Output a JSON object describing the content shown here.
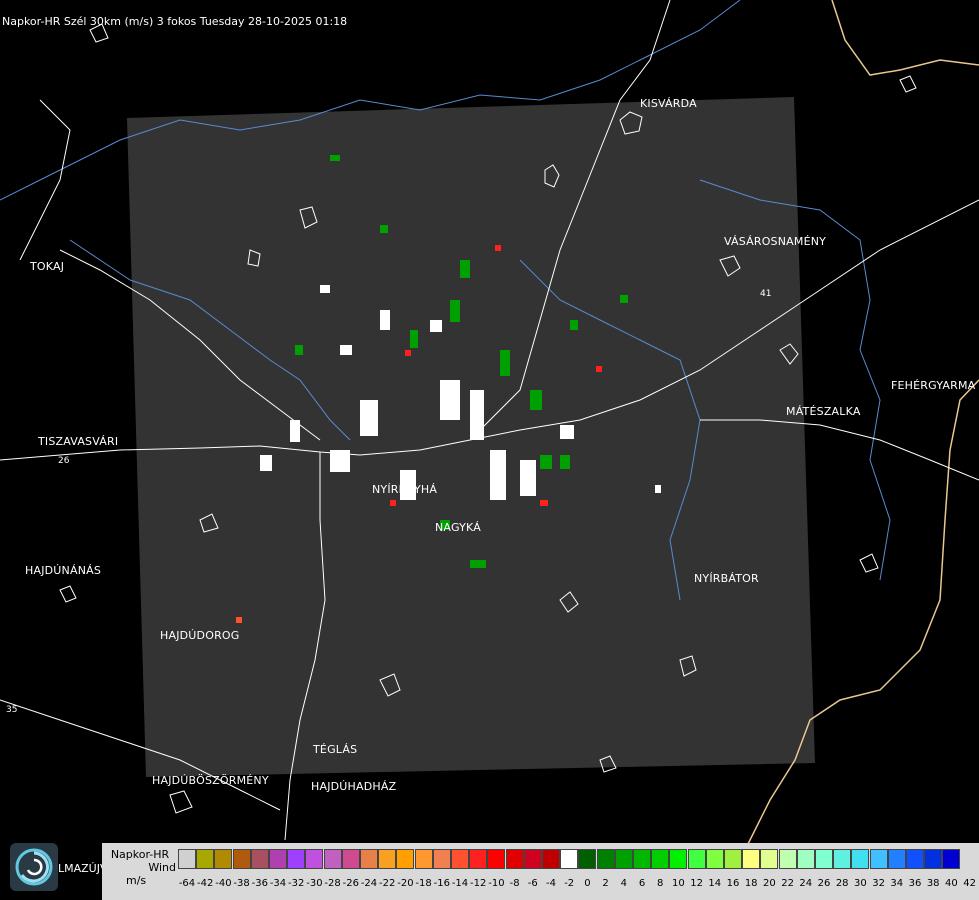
{
  "title": "Napkor-HR Szél 30km (m/s) 3 fokos Tuesday 28-10-2025 01:18",
  "cities": {
    "kisvarda": "KISVÁRDA",
    "tokaj": "TOKAJ",
    "vasarosnameny": "VÁSÁROSNAMÉNY",
    "tiszavasvari": "TISZAVASVÁRI",
    "fehergyarmat": "FEHÉRGYARMA",
    "mateszalka": "MÁTÉSZALKA",
    "nyiregyhaza": "NYÍREGYHÁ",
    "nagykallo": "NAGYKÁ",
    "hajdunanas": "HAJDÚNÁNÁS",
    "nyirbator": "NYÍRBÁTOR",
    "hajdudorog": "HAJDÚDOROG",
    "teglas": "TÉGLÁS",
    "hajduboszormeny": "HAJDÚBÖSZÖRMÉNY",
    "hajduhadhaz": "HAJDÚHADHÁZ"
  },
  "road_labels": {
    "r1": "26",
    "r2": "35",
    "r3": "41"
  },
  "logo_text": "LMAZÚJVÁR",
  "legend": {
    "line1": "Napkor-HR",
    "line2": "Wind",
    "line3": "m/s",
    "ticks": [
      "-64",
      "-42",
      "-40",
      "-38",
      "-36",
      "-34",
      "-32",
      "-30",
      "-28",
      "-26",
      "-24",
      "-22",
      "-20",
      "-18",
      "-16",
      "-14",
      "-12",
      "-10",
      "-8",
      "-6",
      "-4",
      "-2",
      "0",
      "2",
      "4",
      "6",
      "8",
      "10",
      "12",
      "14",
      "16",
      "18",
      "20",
      "22",
      "24",
      "26",
      "28",
      "30",
      "32",
      "34",
      "36",
      "38",
      "40",
      "42"
    ],
    "colors": [
      "#d0d0d0",
      "#a8a800",
      "#b08a00",
      "#b05a10",
      "#a85060",
      "#b040b0",
      "#a040ff",
      "#c050e0",
      "#c060c0",
      "#d04a90",
      "#e8804a",
      "#f8a020",
      "#ffa000",
      "#ff9830",
      "#f08050",
      "#ff5030",
      "#ff2020",
      "#ff0000",
      "#e00000",
      "#d00020",
      "#c00000",
      "#ffffff",
      "#006000",
      "#008000",
      "#00a000",
      "#00b800",
      "#00d000",
      "#00f000",
      "#40ff40",
      "#80ff40",
      "#a0f040",
      "#ffff80",
      "#e0ff90",
      "#c0ffb0",
      "#a0ffc0",
      "#80ffd0",
      "#60f0e0",
      "#40e0f0",
      "#40c0ff",
      "#2080ff",
      "#1050ff",
      "#0030e0",
      "#0000d0"
    ]
  }
}
